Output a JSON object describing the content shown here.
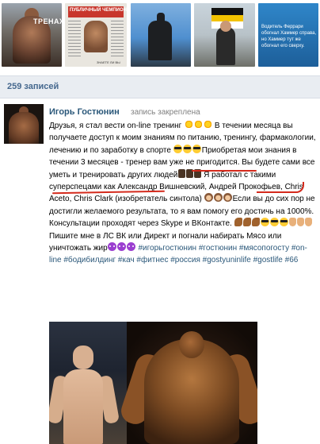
{
  "photos": {
    "items": [
      {
        "name": "photo-bodybuilder-street",
        "caption": "ТРЕНАЖ"
      },
      {
        "name": "photo-magazine",
        "caption": "ПУБЛИЧНЫЙ ЧЕМПИОН",
        "footer": "ЗНАЕТЕ ЛИ ВЫ"
      },
      {
        "name": "photo-statue"
      },
      {
        "name": "photo-flag-man"
      },
      {
        "name": "photo-ferrari-note",
        "caption": "Водитель Феррари обогнал Хаммер справа, но Хаммер тут же обогнал его сверху."
      }
    ]
  },
  "wall": {
    "count_label": "259 записей"
  },
  "post": {
    "author": "Игорь Гостюнин",
    "pinned_label": "запись закреплена",
    "segments": {
      "s1": "Друзья, я стал вести on-line тренинг ",
      "s2": " В течении месяца вы получаете доступ к моим знаниям по питанию, тренингу, фармакологии, лечению и по заработку в спорте ",
      "s3": "Приобретая мои знания в течении 3 месяцев - тренер вам уже не пригодится. Вы будете сами все уметь и тренировать других людей",
      "s4": " Я работал с такими суперспецами как Александр Вишневский, Андрей Прокофьев, Chris Aceto, Chris Clark (изобретатель синтола) ",
      "s5": "Если вы до сих пор не достигли желаемого результата, то я вам помогу его достичь на 1000%. Консультации проходят через Skype и ВКонтакте. ",
      "s6": " Пишите мне в ЛС ВК или Директ и погнали набирать Мясо или уничтожать жир",
      "hashtags": "#игорьгостюнин #гостюнин #мясопогосту #on-line #бодибилдинг #кач #фитнес #россия #gostyuninlife #gostlife #66"
    },
    "emoji_sets": {
      "sun": [
        "sun",
        "sun",
        "sun"
      ],
      "glasses": [
        "glasses",
        "glasses",
        "glasses"
      ],
      "horns": [
        "horns",
        "horns",
        "horns"
      ],
      "monkeys": [
        "monkey",
        "monkey",
        "monkey"
      ],
      "arms": [
        "arm",
        "arm",
        "arm"
      ],
      "glasses_ok": [
        "glasses",
        "glasses",
        "glasses",
        "ok",
        "ok",
        "ok"
      ],
      "devils": [
        "devil",
        "devil",
        "devil"
      ]
    },
    "colors": {
      "link": "#2b587a",
      "header_bg": "#e9edf2",
      "underline": "#d42a1c"
    }
  }
}
